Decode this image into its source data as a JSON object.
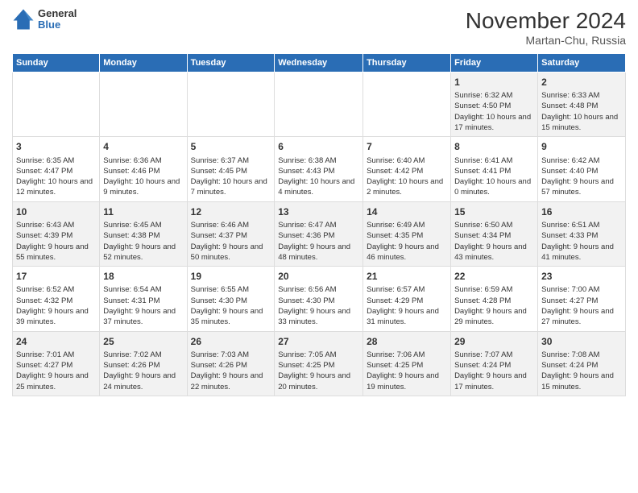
{
  "logo": {
    "general": "General",
    "blue": "Blue"
  },
  "header": {
    "title": "November 2024",
    "subtitle": "Martan-Chu, Russia"
  },
  "weekdays": [
    "Sunday",
    "Monday",
    "Tuesday",
    "Wednesday",
    "Thursday",
    "Friday",
    "Saturday"
  ],
  "weeks": [
    [
      {
        "day": "",
        "info": ""
      },
      {
        "day": "",
        "info": ""
      },
      {
        "day": "",
        "info": ""
      },
      {
        "day": "",
        "info": ""
      },
      {
        "day": "",
        "info": ""
      },
      {
        "day": "1",
        "info": "Sunrise: 6:32 AM\nSunset: 4:50 PM\nDaylight: 10 hours and 17 minutes."
      },
      {
        "day": "2",
        "info": "Sunrise: 6:33 AM\nSunset: 4:48 PM\nDaylight: 10 hours and 15 minutes."
      }
    ],
    [
      {
        "day": "3",
        "info": "Sunrise: 6:35 AM\nSunset: 4:47 PM\nDaylight: 10 hours and 12 minutes."
      },
      {
        "day": "4",
        "info": "Sunrise: 6:36 AM\nSunset: 4:46 PM\nDaylight: 10 hours and 9 minutes."
      },
      {
        "day": "5",
        "info": "Sunrise: 6:37 AM\nSunset: 4:45 PM\nDaylight: 10 hours and 7 minutes."
      },
      {
        "day": "6",
        "info": "Sunrise: 6:38 AM\nSunset: 4:43 PM\nDaylight: 10 hours and 4 minutes."
      },
      {
        "day": "7",
        "info": "Sunrise: 6:40 AM\nSunset: 4:42 PM\nDaylight: 10 hours and 2 minutes."
      },
      {
        "day": "8",
        "info": "Sunrise: 6:41 AM\nSunset: 4:41 PM\nDaylight: 10 hours and 0 minutes."
      },
      {
        "day": "9",
        "info": "Sunrise: 6:42 AM\nSunset: 4:40 PM\nDaylight: 9 hours and 57 minutes."
      }
    ],
    [
      {
        "day": "10",
        "info": "Sunrise: 6:43 AM\nSunset: 4:39 PM\nDaylight: 9 hours and 55 minutes."
      },
      {
        "day": "11",
        "info": "Sunrise: 6:45 AM\nSunset: 4:38 PM\nDaylight: 9 hours and 52 minutes."
      },
      {
        "day": "12",
        "info": "Sunrise: 6:46 AM\nSunset: 4:37 PM\nDaylight: 9 hours and 50 minutes."
      },
      {
        "day": "13",
        "info": "Sunrise: 6:47 AM\nSunset: 4:36 PM\nDaylight: 9 hours and 48 minutes."
      },
      {
        "day": "14",
        "info": "Sunrise: 6:49 AM\nSunset: 4:35 PM\nDaylight: 9 hours and 46 minutes."
      },
      {
        "day": "15",
        "info": "Sunrise: 6:50 AM\nSunset: 4:34 PM\nDaylight: 9 hours and 43 minutes."
      },
      {
        "day": "16",
        "info": "Sunrise: 6:51 AM\nSunset: 4:33 PM\nDaylight: 9 hours and 41 minutes."
      }
    ],
    [
      {
        "day": "17",
        "info": "Sunrise: 6:52 AM\nSunset: 4:32 PM\nDaylight: 9 hours and 39 minutes."
      },
      {
        "day": "18",
        "info": "Sunrise: 6:54 AM\nSunset: 4:31 PM\nDaylight: 9 hours and 37 minutes."
      },
      {
        "day": "19",
        "info": "Sunrise: 6:55 AM\nSunset: 4:30 PM\nDaylight: 9 hours and 35 minutes."
      },
      {
        "day": "20",
        "info": "Sunrise: 6:56 AM\nSunset: 4:30 PM\nDaylight: 9 hours and 33 minutes."
      },
      {
        "day": "21",
        "info": "Sunrise: 6:57 AM\nSunset: 4:29 PM\nDaylight: 9 hours and 31 minutes."
      },
      {
        "day": "22",
        "info": "Sunrise: 6:59 AM\nSunset: 4:28 PM\nDaylight: 9 hours and 29 minutes."
      },
      {
        "day": "23",
        "info": "Sunrise: 7:00 AM\nSunset: 4:27 PM\nDaylight: 9 hours and 27 minutes."
      }
    ],
    [
      {
        "day": "24",
        "info": "Sunrise: 7:01 AM\nSunset: 4:27 PM\nDaylight: 9 hours and 25 minutes."
      },
      {
        "day": "25",
        "info": "Sunrise: 7:02 AM\nSunset: 4:26 PM\nDaylight: 9 hours and 24 minutes."
      },
      {
        "day": "26",
        "info": "Sunrise: 7:03 AM\nSunset: 4:26 PM\nDaylight: 9 hours and 22 minutes."
      },
      {
        "day": "27",
        "info": "Sunrise: 7:05 AM\nSunset: 4:25 PM\nDaylight: 9 hours and 20 minutes."
      },
      {
        "day": "28",
        "info": "Sunrise: 7:06 AM\nSunset: 4:25 PM\nDaylight: 9 hours and 19 minutes."
      },
      {
        "day": "29",
        "info": "Sunrise: 7:07 AM\nSunset: 4:24 PM\nDaylight: 9 hours and 17 minutes."
      },
      {
        "day": "30",
        "info": "Sunrise: 7:08 AM\nSunset: 4:24 PM\nDaylight: 9 hours and 15 minutes."
      }
    ]
  ]
}
